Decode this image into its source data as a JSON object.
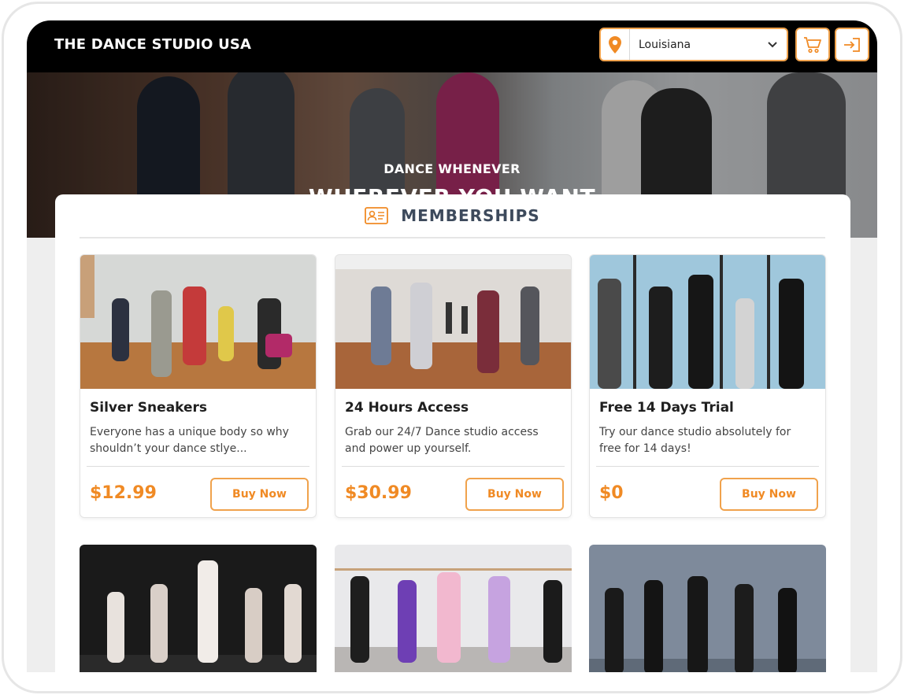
{
  "header": {
    "brand": "THE DANCE STUDIO USA",
    "location": {
      "selected": "Louisiana",
      "icon": "map-pin-icon"
    },
    "cart_icon": "cart-icon",
    "login_icon": "sign-in-icon"
  },
  "hero": {
    "subtitle": "DANCE WHENEVER",
    "title": "WHEREVER YOU WANT"
  },
  "memberships": {
    "icon": "id-card-icon",
    "title": "MEMBERSHIPS",
    "cards": [
      {
        "title": "Silver Sneakers",
        "description": "Everyone has a unique body so why shouldn’t your dance stlye...",
        "price": "$12.99",
        "button": "Buy Now"
      },
      {
        "title": "24 Hours Access",
        "description": "Grab our 24/7 Dance studio access and power up yourself.",
        "price": "$30.99",
        "button": "Buy Now"
      },
      {
        "title": "Free 14 Days Trial",
        "description": "Try our dance studio absolutely for free for 14 days!",
        "price": "$0",
        "button": "Buy Now"
      }
    ]
  },
  "colors": {
    "accent": "#f08a24",
    "accent_border": "#f0a24c",
    "header_bg": "#000000",
    "heading_text": "#3d4a5c"
  }
}
